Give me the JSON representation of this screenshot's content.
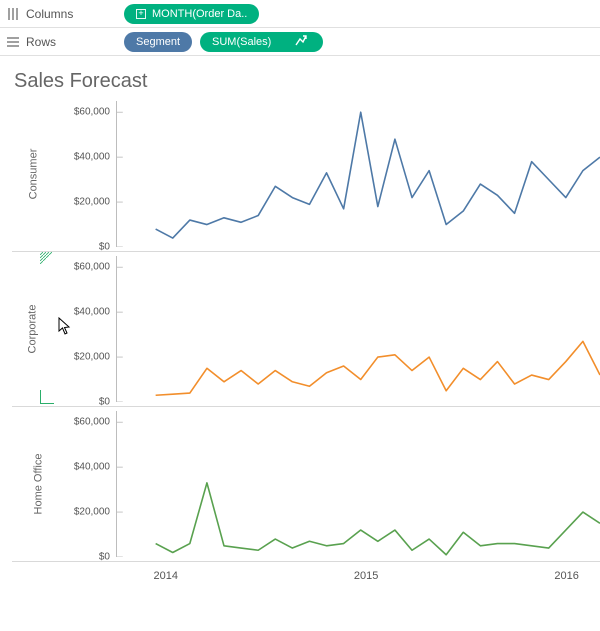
{
  "shelves": {
    "columns_label": "Columns",
    "rows_label": "Rows",
    "columns_pills": [
      {
        "label": "MONTH(Order Da..",
        "color": "green",
        "expandable": true
      }
    ],
    "rows_pills": [
      {
        "label": "Segment",
        "color": "blue"
      },
      {
        "label": "SUM(Sales)",
        "color": "green",
        "forecast": true
      }
    ]
  },
  "title": "Sales Forecast",
  "y_tick_labels": [
    "$0",
    "$20,000",
    "$40,000",
    "$60,000"
  ],
  "x_tick_labels": [
    "2014",
    "2015",
    "2016"
  ],
  "segments": [
    "Consumer",
    "Corporate",
    "Home Office"
  ],
  "colors": {
    "Consumer": "#4e79a7",
    "Corporate": "#f28e2b",
    "Home Office": "#59a14f",
    "pill_green": "#00b180",
    "pill_blue": "#4e79a7"
  },
  "chart_data": {
    "type": "line",
    "title": "Sales Forecast",
    "xlabel": "",
    "ylabel": "",
    "ylim": [
      0,
      65000
    ],
    "x": [
      "2014-01",
      "2014-02",
      "2014-03",
      "2014-04",
      "2014-05",
      "2014-06",
      "2014-07",
      "2014-08",
      "2014-09",
      "2014-10",
      "2014-11",
      "2014-12",
      "2015-01",
      "2015-02",
      "2015-03",
      "2015-04",
      "2015-05",
      "2015-06",
      "2015-07",
      "2015-08",
      "2015-09",
      "2015-10",
      "2015-11",
      "2015-12",
      "2016-01",
      "2016-02",
      "2016-03"
    ],
    "x_ticks": [
      "2014",
      "2015",
      "2016"
    ],
    "y_ticks": [
      0,
      20000,
      40000,
      60000
    ],
    "series": [
      {
        "name": "Consumer",
        "color": "#4e79a7",
        "values": [
          8000,
          4000,
          12000,
          10000,
          13000,
          11000,
          14000,
          27000,
          22000,
          19000,
          33000,
          17000,
          60000,
          18000,
          48000,
          22000,
          34000,
          10000,
          16000,
          28000,
          23000,
          15000,
          38000,
          30000,
          22000,
          34000,
          40000
        ]
      },
      {
        "name": "Corporate",
        "color": "#f28e2b",
        "values": [
          3000,
          3500,
          4000,
          15000,
          9000,
          14000,
          8000,
          14000,
          9000,
          7000,
          13000,
          16000,
          10000,
          20000,
          21000,
          14000,
          20000,
          5000,
          15000,
          10000,
          18000,
          8000,
          12000,
          10000,
          18000,
          27000,
          12000
        ]
      },
      {
        "name": "Home Office",
        "color": "#59a14f",
        "values": [
          6000,
          2000,
          6000,
          33000,
          5000,
          4000,
          3000,
          8000,
          4000,
          7000,
          5000,
          6000,
          12000,
          7000,
          12000,
          3000,
          8000,
          1000,
          11000,
          5000,
          6000,
          6000,
          5000,
          4000,
          12000,
          20000,
          15000
        ]
      }
    ]
  }
}
